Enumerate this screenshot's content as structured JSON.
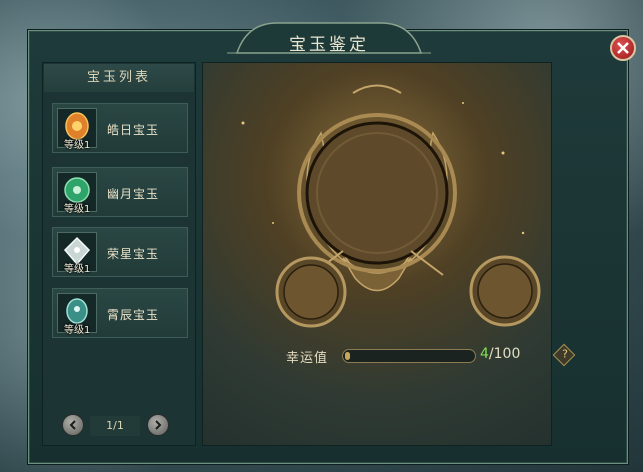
{
  "window": {
    "title": "宝玉鉴定"
  },
  "gem_list": {
    "header": "宝玉列表",
    "items": [
      {
        "name": "皓日宝玉",
        "level": "等级1",
        "color": "#e0802a"
      },
      {
        "name": "幽月宝玉",
        "level": "等级1",
        "color": "#2ea36a"
      },
      {
        "name": "荣星宝玉",
        "level": "等级1",
        "color": "#c9d6d4"
      },
      {
        "name": "霄辰宝玉",
        "level": "等级1",
        "color": "#3a8f86"
      }
    ],
    "pager": {
      "current_of_total": "1/1"
    }
  },
  "appraisal": {
    "luck_label": "幸运值",
    "luck_current": "4",
    "luck_max": "/100",
    "luck_fraction": 0.04,
    "help_label": "?"
  },
  "colors": {
    "accent_gold": "#c8a75a",
    "luck_green": "#7ee04f",
    "close_red": "#c03030"
  }
}
